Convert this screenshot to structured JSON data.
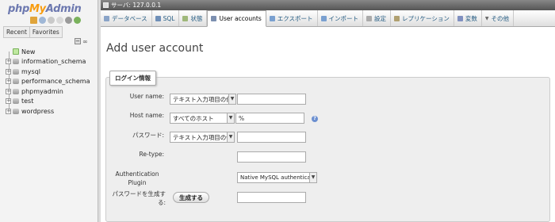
{
  "nav": {
    "logo": {
      "php": "php",
      "my": "My",
      "admin": "Admin"
    },
    "icons": [
      "home-icon",
      "exit-icon",
      "help-icon",
      "docs-icon",
      "settings-icon",
      "reload-icon"
    ],
    "tabs": [
      "Recent",
      "Favorites"
    ],
    "link_icon": "link-icon",
    "tree": [
      {
        "label": "New",
        "type": "new"
      },
      {
        "label": "information_schema",
        "type": "db"
      },
      {
        "label": "mysql",
        "type": "db"
      },
      {
        "label": "performance_schema",
        "type": "db"
      },
      {
        "label": "phpmyadmin",
        "type": "db"
      },
      {
        "label": "test",
        "type": "db"
      },
      {
        "label": "wordpress",
        "type": "db"
      }
    ]
  },
  "server": {
    "label": "サーバ: 127.0.0.1"
  },
  "tabs": [
    {
      "label": "データベース",
      "icon": "database-icon",
      "color": "#8aa4c8"
    },
    {
      "label": "SQL",
      "icon": "sql-icon",
      "color": "#6f8fb8"
    },
    {
      "label": "状態",
      "icon": "status-icon",
      "color": "#9fb87a"
    },
    {
      "label": "User accounts",
      "icon": "users-icon",
      "color": "#7c8fb0",
      "active": true
    },
    {
      "label": "エクスポート",
      "icon": "export-icon",
      "color": "#7aa0d0"
    },
    {
      "label": "インポート",
      "icon": "import-icon",
      "color": "#7aa0d0"
    },
    {
      "label": "設定",
      "icon": "settings-icon",
      "color": "#aaaaaa"
    },
    {
      "label": "レプリケーション",
      "icon": "replication-icon",
      "color": "#b0a070"
    },
    {
      "label": "変数",
      "icon": "variables-icon",
      "color": "#8090c0"
    },
    {
      "label": "その他",
      "icon": "more-icon",
      "color": "#666666"
    }
  ],
  "page": {
    "title": "Add user account"
  },
  "form": {
    "legend": "ログイン情報",
    "username": {
      "label": "User name:",
      "select": "テキスト入力項目の値",
      "value": ""
    },
    "hostname": {
      "label": "Host name:",
      "select": "すべてのホスト",
      "value": "%"
    },
    "password": {
      "label": "パスワード:",
      "select": "テキスト入力項目の値",
      "value": ""
    },
    "retype": {
      "label": "Re-type:",
      "value": ""
    },
    "auth": {
      "label": "Authentication Plugin",
      "select": "Native MySQL authentication"
    },
    "generate": {
      "label": "パスワードを生成する:",
      "button": "生成する",
      "value": ""
    }
  }
}
